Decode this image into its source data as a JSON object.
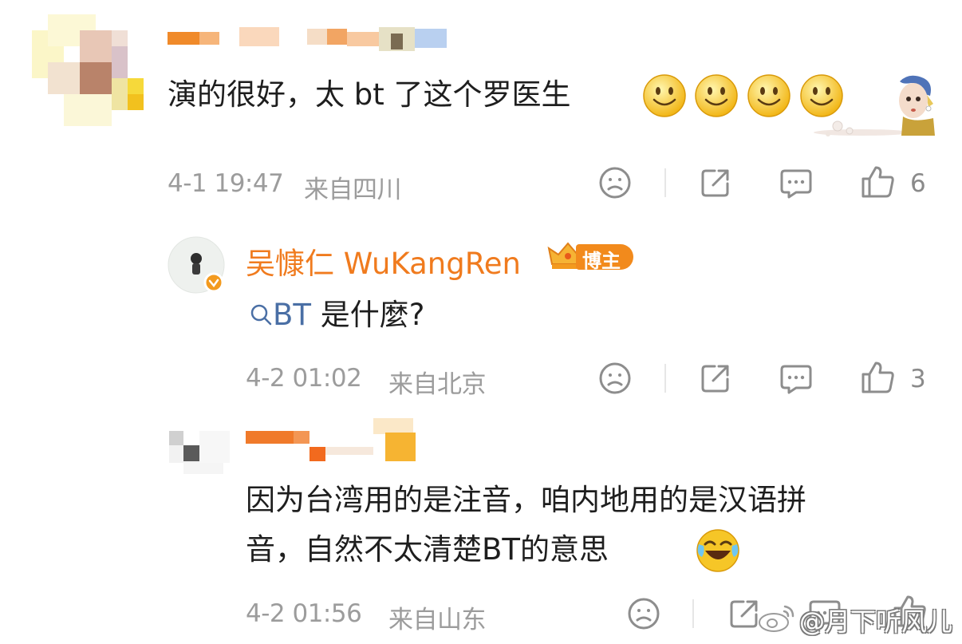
{
  "comment1": {
    "text": "演的很好，太 bt 了这个罗医生",
    "emoji_count": 4,
    "time": "4-1 19:47",
    "location": "来自四川",
    "likes": "6"
  },
  "reply1": {
    "author": "吴慷仁 WuKangRen",
    "badge": "博主",
    "search_term": "BT",
    "text": "是什麼?",
    "time": "4-2 01:02",
    "location": "来自北京",
    "likes": "3"
  },
  "reply2": {
    "text_line1": "因为台湾用的是注音，咱内地用的是汉语拼",
    "text_line2": "音，自然不太清楚BT的意思",
    "time": "4-2 01:56",
    "location": "来自山东"
  },
  "watermark": "@月下听风儿",
  "colors": {
    "accent": "#f07b1e",
    "meta": "#9c9c9c",
    "link": "#4a6fa5",
    "icon": "#8d8d8d"
  }
}
